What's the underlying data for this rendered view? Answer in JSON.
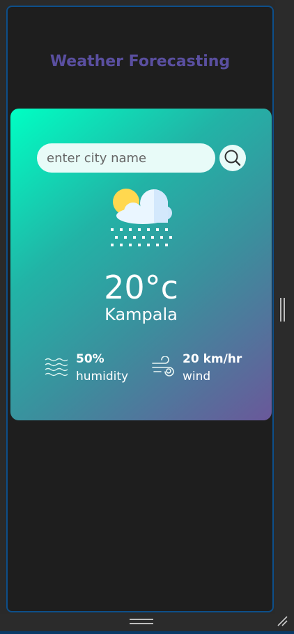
{
  "app": {
    "title": "Weather Forecasting"
  },
  "search": {
    "placeholder": "enter city name",
    "value": "",
    "button_icon": "search-icon"
  },
  "weather": {
    "condition_icon": "sun-cloud-snow-icon",
    "temperature": "20°c",
    "city": "Kampala"
  },
  "stats": {
    "humidity": {
      "value": "50%",
      "label": "humidity",
      "icon": "humidity-waves-icon"
    },
    "wind": {
      "value": "20 km/hr",
      "label": "wind",
      "icon": "wind-icon"
    }
  },
  "colors": {
    "title": "#5a4fa0",
    "card_gradient_start": "#00ffc3",
    "card_gradient_end": "#6a589a",
    "background": "#1e1e1e",
    "frame_border": "#0d4f8a"
  }
}
